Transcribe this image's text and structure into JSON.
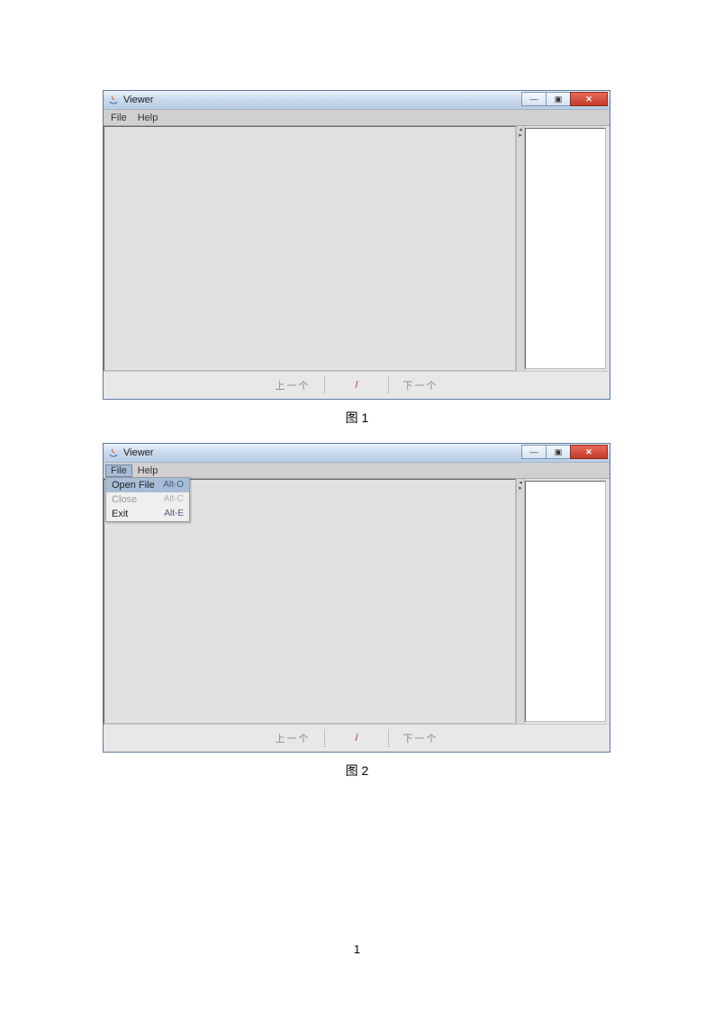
{
  "figure1": {
    "caption": "图 1",
    "window": {
      "title": "Viewer",
      "menubar": {
        "file": "File",
        "help": "Help"
      },
      "nav": {
        "prev": "上一个",
        "count": "/",
        "next": "下一个"
      },
      "winbtns": {
        "min": "—",
        "max": "▣",
        "close": "✕"
      }
    }
  },
  "figure2": {
    "caption": "图 2",
    "window": {
      "title": "Viewer",
      "menubar": {
        "file": "File",
        "help": "Help"
      },
      "filemenu": {
        "open": {
          "label": "Open File",
          "accel": "Alt-O"
        },
        "close": {
          "label": "Close",
          "accel": "Alt-C"
        },
        "exit": {
          "label": "Exit",
          "accel": "Alt-E"
        }
      },
      "nav": {
        "prev": "上一个",
        "count": "/",
        "next": "下一个"
      },
      "winbtns": {
        "min": "—",
        "max": "▣",
        "close": "✕"
      }
    }
  },
  "page_number": "1"
}
